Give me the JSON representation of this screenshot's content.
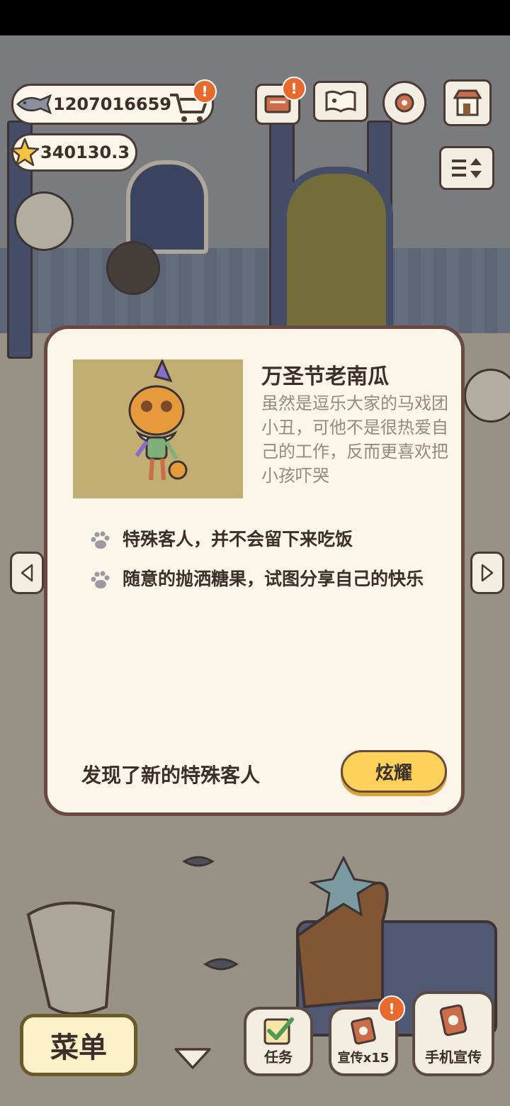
{
  "currency": {
    "fish_count": "1207016659",
    "star_count": "340130.3",
    "alert_mark": "!"
  },
  "top_icons": {
    "alert_mark": "!"
  },
  "modal": {
    "title": "万圣节老南瓜",
    "description": "虽然是逗乐大家的马戏团小丑，可他不是很热爱自己的工作，反而更喜欢把小孩吓哭",
    "traits": [
      "特殊客人，并不会留下来吃饭",
      "随意的抛洒糖果，试图分享自己的快乐"
    ],
    "footer_text": "发现了新的特殊客人",
    "show_button": "炫耀"
  },
  "bottom_bar": {
    "menu_label": "菜单",
    "tasks_label": "任务",
    "promote_label": "宣传x15",
    "phone_promote_label": "手机宣传",
    "alert_mark": "!"
  },
  "colors": {
    "accent_button": "#fcd25a",
    "badge": "#e86a2c",
    "modal_bg": "#fbf5ea",
    "portrait_bg": "#c2ad73"
  }
}
